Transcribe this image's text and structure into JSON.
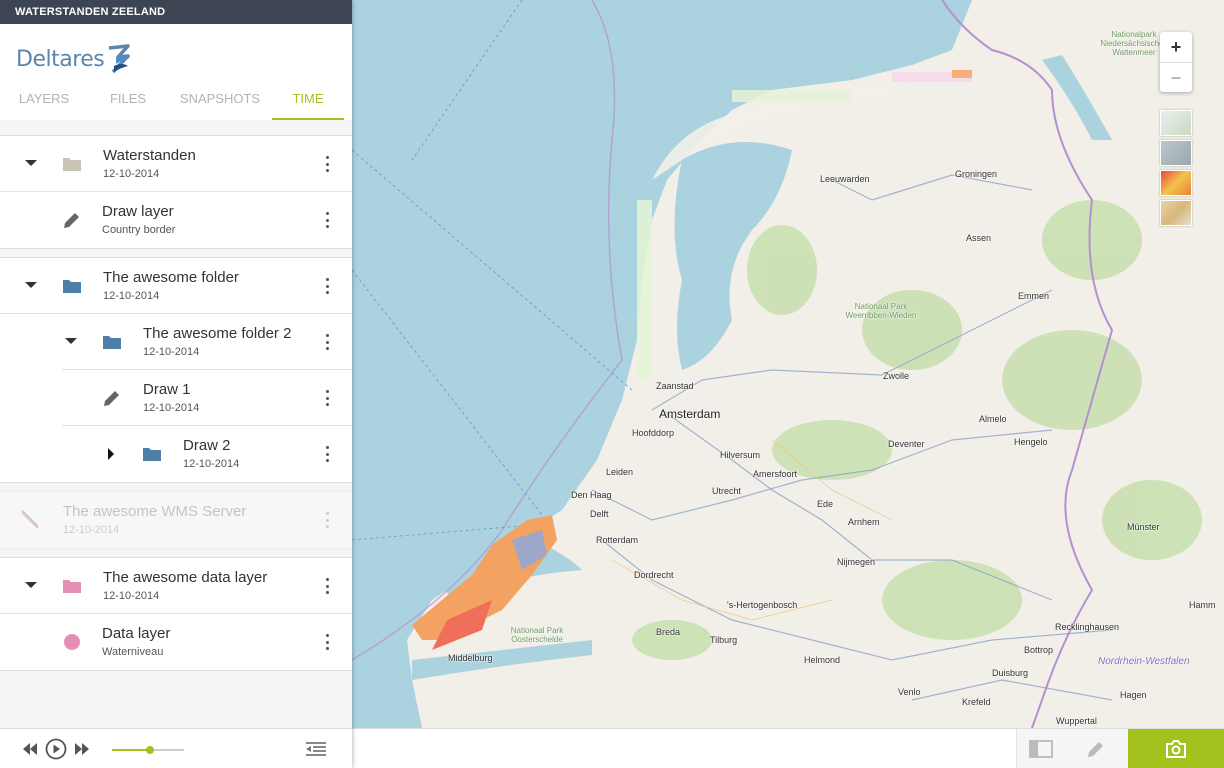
{
  "app": {
    "title": "WATERSTANDEN ZEELAND",
    "logo_text": "Deltares"
  },
  "tabs": [
    {
      "label": "LAYERS"
    },
    {
      "label": "FILES"
    },
    {
      "label": "SNAPSHOTS"
    },
    {
      "label": "TIME",
      "active": true
    }
  ],
  "layers": {
    "waterstanden": {
      "title": "Waterstanden",
      "sub": "12-10-2014",
      "icon": "folder-icon",
      "color": "#c9c4b4"
    },
    "draw_layer": {
      "title": "Draw layer",
      "sub": "Country border",
      "icon": "pencil-icon"
    },
    "awesome_folder": {
      "title": "The awesome folder",
      "sub": "12-10-2014",
      "icon": "folder-icon",
      "color": "#4f7fa8"
    },
    "awesome_folder_2": {
      "title": "The awesome folder 2",
      "sub": "12-10-2014",
      "icon": "folder-icon",
      "color": "#4f7fa8"
    },
    "draw_1": {
      "title": "Draw 1",
      "sub": "12-10-2014",
      "icon": "pencil-icon"
    },
    "draw_2": {
      "title": "Draw 2",
      "sub": "12-10-2014",
      "icon": "folder-icon",
      "color": "#4f7fa8"
    },
    "wms_server": {
      "title": "The awesome WMS Server",
      "sub": "12-10-2014",
      "icon": "disabled-icon",
      "disabled": true
    },
    "data_layer_folder": {
      "title": "The awesome data layer",
      "sub": "12-10-2014",
      "icon": "folder-icon",
      "color": "#e58fb4"
    },
    "data_layer": {
      "title": "Data layer",
      "sub": "Waterniveau",
      "icon": "circle-icon",
      "color": "#e58fb4"
    }
  },
  "player": {
    "progress": 0.53
  },
  "map": {
    "zoom_in": "+",
    "zoom_out": "−",
    "cities": [
      "Leeuwarden",
      "Groningen",
      "Assen",
      "Emmen",
      "Zwolle",
      "Zaanstad",
      "Amsterdam",
      "Hoofddorp",
      "Almelo",
      "Hengelo",
      "Deventer",
      "Hilversum",
      "Amersfoort",
      "Leiden",
      "Den Haag",
      "Delft",
      "Utrecht",
      "Ede",
      "Arnhem",
      "Rotterdam",
      "Nijmegen",
      "Dordrecht",
      "Münster",
      "'s-Hertogenbosch",
      "Breda",
      "Tilburg",
      "Helmond",
      "Middelburg",
      "Recklinghausen",
      "Hamm",
      "Bottrop",
      "Duisburg",
      "Venlo",
      "Krefeld",
      "Hagen",
      "Wuppertal"
    ],
    "parks": [
      "Nationaal Park Weerribben-Wieden",
      "Nationaal Park Oosterschelde",
      "Nationalpark Niedersächsisches Wattenmeer"
    ],
    "region": "Nordrhein-Westfalen",
    "baselayers": [
      "base-osm",
      "base-grey",
      "base-heat",
      "base-terrain"
    ]
  }
}
